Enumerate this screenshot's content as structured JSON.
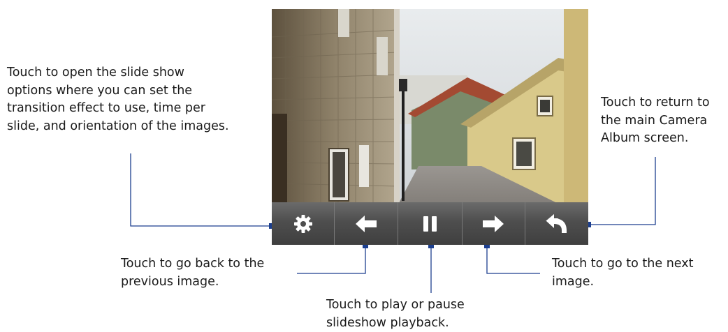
{
  "callouts": {
    "settings": [
      "Touch to open the slide show",
      "options where you can set the",
      "transition effect to use, time per",
      "slide, and orientation of the images."
    ],
    "return": [
      "Touch to return to",
      "the main Camera",
      "Album screen."
    ],
    "previous": [
      "Touch to go back to the",
      "previous image."
    ],
    "play_pause": [
      "Touch to play or pause",
      "slideshow playback."
    ],
    "next": [
      "Touch to go to the next",
      "image."
    ]
  },
  "toolbar": {
    "buttons": [
      {
        "name": "settings",
        "icon": "gear-icon"
      },
      {
        "name": "previous",
        "icon": "arrow-left-icon"
      },
      {
        "name": "pause",
        "icon": "pause-icon"
      },
      {
        "name": "next",
        "icon": "arrow-right-icon"
      },
      {
        "name": "return",
        "icon": "return-arrow-icon"
      }
    ]
  },
  "colors": {
    "callout_line": "#1c3f8f",
    "toolbar": "#4e4e4e",
    "icon": "#ffffff"
  }
}
